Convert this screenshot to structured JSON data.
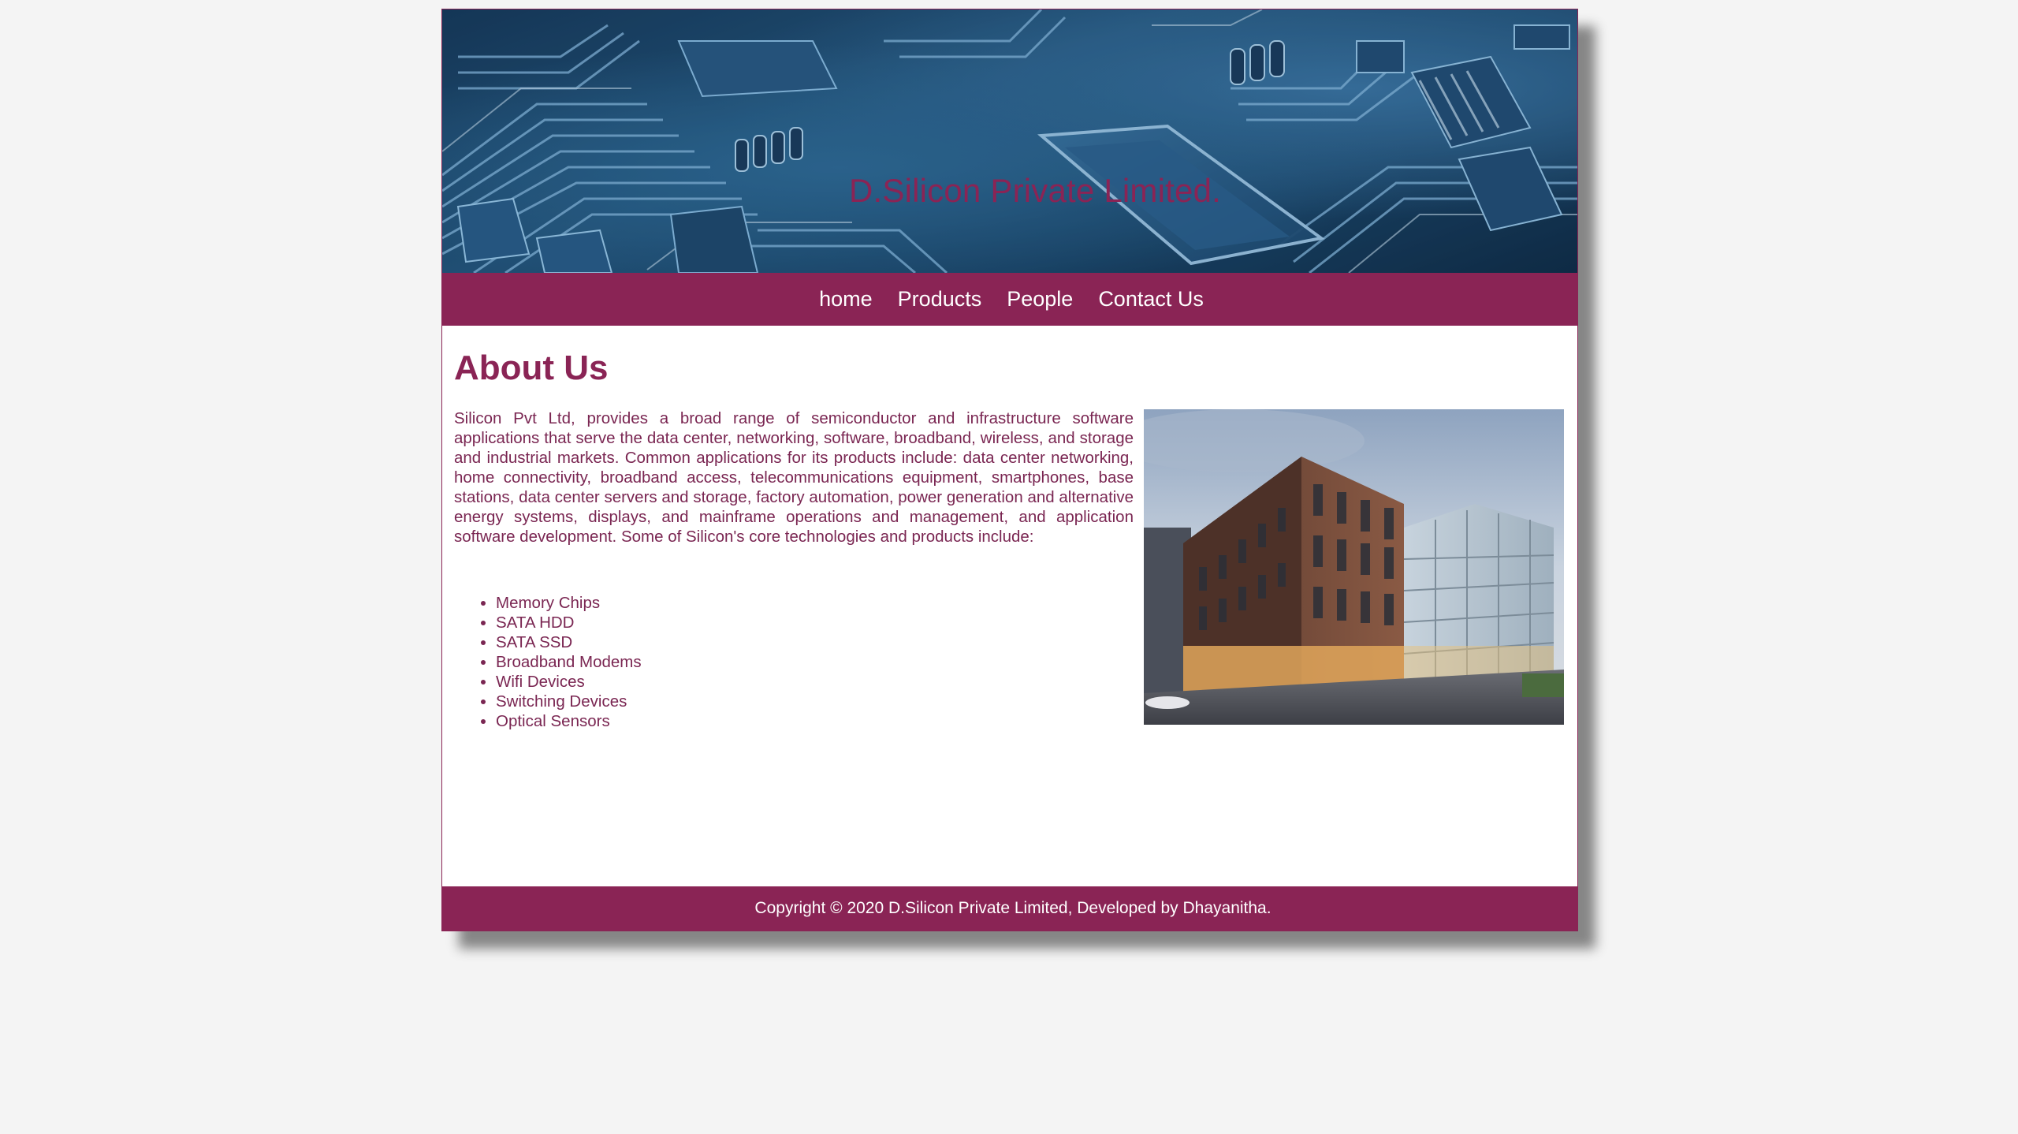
{
  "header": {
    "site_title": "D.Silicon Private Limited."
  },
  "nav": {
    "items": [
      {
        "label": "home"
      },
      {
        "label": "Products"
      },
      {
        "label": "People"
      },
      {
        "label": "Contact Us"
      }
    ]
  },
  "main": {
    "heading": "About Us",
    "intro": "Silicon Pvt Ltd, provides a broad range of semiconductor and infrastructure software applications that serve the data center, networking, software, broadband, wireless, and storage and industrial markets. Common applications for its products include: data center networking, home connectivity, broadband access, telecommunications equipment, smartphones, base stations, data center servers and storage, factory automation, power generation and alternative energy systems, displays, and mainframe operations and management, and application software development. Some of Silicon's core technologies and products include:",
    "products": [
      "Memory Chips",
      "SATA HDD",
      "SATA SSD",
      "Broadband Modems",
      "Wifi Devices",
      "Switching Devices",
      "Optical Sensors"
    ]
  },
  "footer": {
    "copyright": "Copyright © 2020 D.Silicon Private Limited, Developed by Dhayanitha."
  },
  "colors": {
    "brand": "#8a2455",
    "page_background": "#f4f4f4",
    "text": "#7a2652"
  },
  "icons": {
    "banner_image": "circuit-board-image",
    "content_image": "office-building-image"
  }
}
